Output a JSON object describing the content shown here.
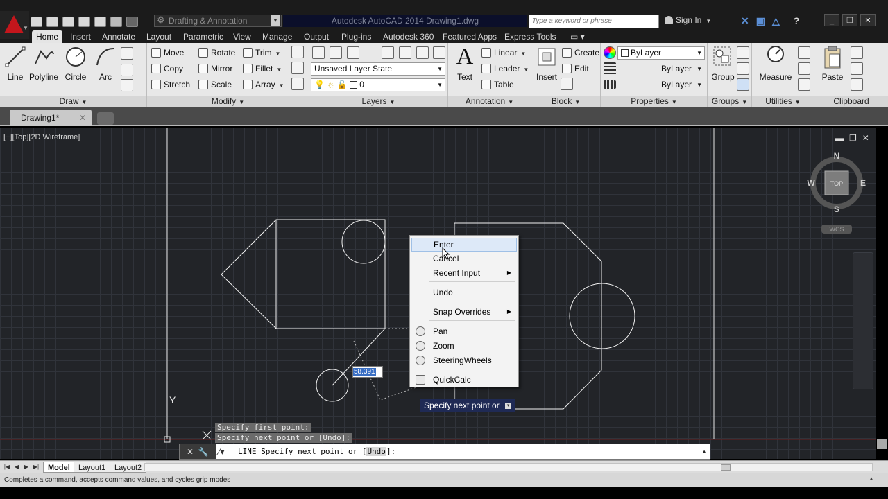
{
  "titlebar": {
    "workspace": "Drafting & Annotation",
    "app_title": "Autodesk AutoCAD 2014    Drawing1.dwg",
    "search_placeholder": "Type a keyword or phrase",
    "sign_in": "Sign In"
  },
  "ribbon_tabs": [
    "Home",
    "Insert",
    "Annotate",
    "Layout",
    "Parametric",
    "View",
    "Manage",
    "Output",
    "Plug-ins",
    "Autodesk 360",
    "Featured Apps",
    "Express Tools"
  ],
  "ribbon": {
    "draw": {
      "title": "Draw",
      "line": "Line",
      "polyline": "Polyline",
      "circle": "Circle",
      "arc": "Arc"
    },
    "modify": {
      "title": "Modify",
      "move": "Move",
      "rotate": "Rotate",
      "trim": "Trim",
      "copy": "Copy",
      "mirror": "Mirror",
      "fillet": "Fillet",
      "stretch": "Stretch",
      "scale": "Scale",
      "array": "Array"
    },
    "layers": {
      "title": "Layers",
      "layer_state": "Unsaved Layer State",
      "layer_current": "0"
    },
    "annotation": {
      "title": "Annotation",
      "text": "Text",
      "linear": "Linear",
      "leader": "Leader",
      "table": "Table"
    },
    "block": {
      "title": "Block",
      "insert": "Insert",
      "create": "Create",
      "edit": "Edit"
    },
    "properties": {
      "title": "Properties",
      "color": "ByLayer",
      "linetype": "ByLayer",
      "lineweight": "ByLayer"
    },
    "groups": {
      "title": "Groups",
      "group": "Group"
    },
    "utilities": {
      "title": "Utilities",
      "measure": "Measure"
    },
    "clipboard": {
      "title": "Clipboard",
      "paste": "Paste"
    }
  },
  "file_tab": {
    "name": "Drawing1*"
  },
  "viewport": {
    "controls": "[−][Top][2D Wireframe]",
    "compass": {
      "n": "N",
      "s": "S",
      "e": "E",
      "w": "W",
      "face": "TOP",
      "wcs": "WCS"
    },
    "ucs_y": "Y"
  },
  "context_menu": {
    "items": [
      "Enter",
      "Cancel",
      "Recent Input",
      "Undo",
      "Snap Overrides",
      "Pan",
      "Zoom",
      "SteeringWheels",
      "QuickCalc"
    ]
  },
  "dynamic_input": {
    "value": "58.391"
  },
  "tooltip": {
    "text": "Specify next point or"
  },
  "command_history": [
    "Specify first point:",
    "Specify next point or [Undo]:"
  ],
  "command_line": {
    "prefix": "LINE Specify next point or [",
    "option": "Undo",
    "suffix": "]:"
  },
  "layout_tabs": [
    "Model",
    "Layout1",
    "Layout2"
  ],
  "status_bar": {
    "text": "Completes a command, accepts command values, and cycles grip modes"
  },
  "colors": {
    "accent": "#c4161c",
    "canvas": "#222428",
    "highlight": "#dde9f8"
  }
}
